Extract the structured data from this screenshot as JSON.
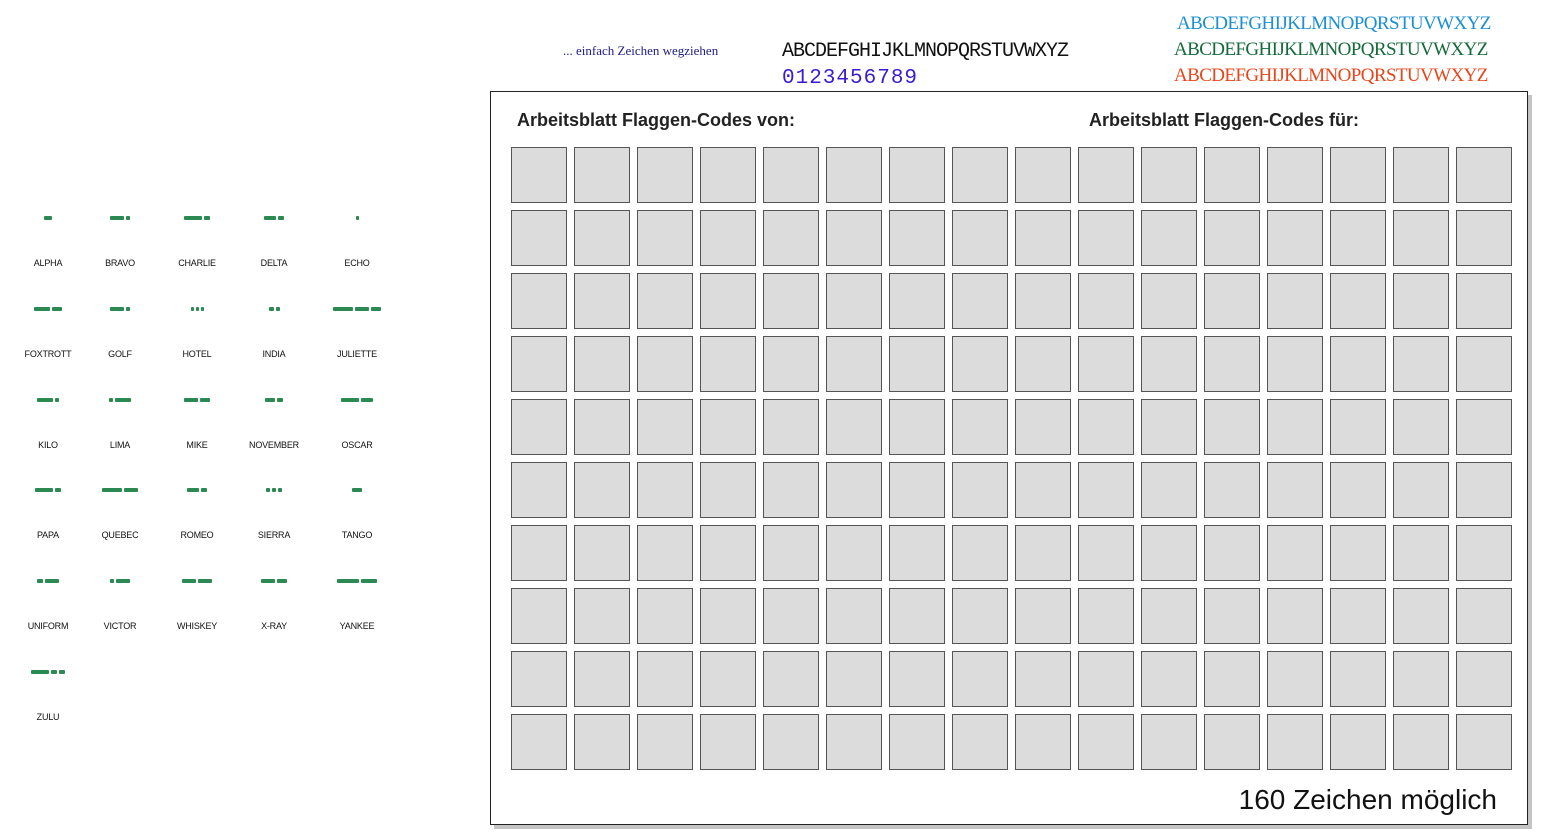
{
  "palette": {
    "hint": "... einfach Zeichen wegziehen",
    "alphabet_mono": "ABCDEFGHIJKLMNOPQRSTUVWXYZ",
    "digits": "0123456789",
    "alphabet_colored": [
      {
        "text": "ABCDEFGHIJKLMNOPQRSTUVWXYZ",
        "color": "#1a8fd6"
      },
      {
        "text": "ABCDEFGHIJKLMNOPQRSTUVWXYZ",
        "color": "#146a3a"
      },
      {
        "text": "ABCDEFGHIJKLMNOPQRSTUVWXYZ",
        "color": "#e8461a"
      }
    ]
  },
  "flag_codes": [
    "ALPHA",
    "BRAVO",
    "CHARLIE",
    "DELTA",
    "ECHO",
    "FOXTROTT",
    "GOLF",
    "HOTEL",
    "INDIA",
    "JULIETTE",
    "KILO",
    "LIMA",
    "MIKE",
    "NOVEMBER",
    "OSCAR",
    "PAPA",
    "QUEBEC",
    "ROMEO",
    "SIERRA",
    "TANGO",
    "UNIFORM",
    "VICTOR",
    "WHISKEY",
    "X-RAY",
    "YANKEE",
    "ZULU"
  ],
  "flag_color": "#2a8a52",
  "worksheet": {
    "title_from": "Arbeitsblatt Flaggen-Codes von:",
    "title_for": "Arbeitsblatt Flaggen-Codes für:",
    "columns": 16,
    "rows": 10,
    "capacity_text": "160 Zeichen möglich"
  }
}
